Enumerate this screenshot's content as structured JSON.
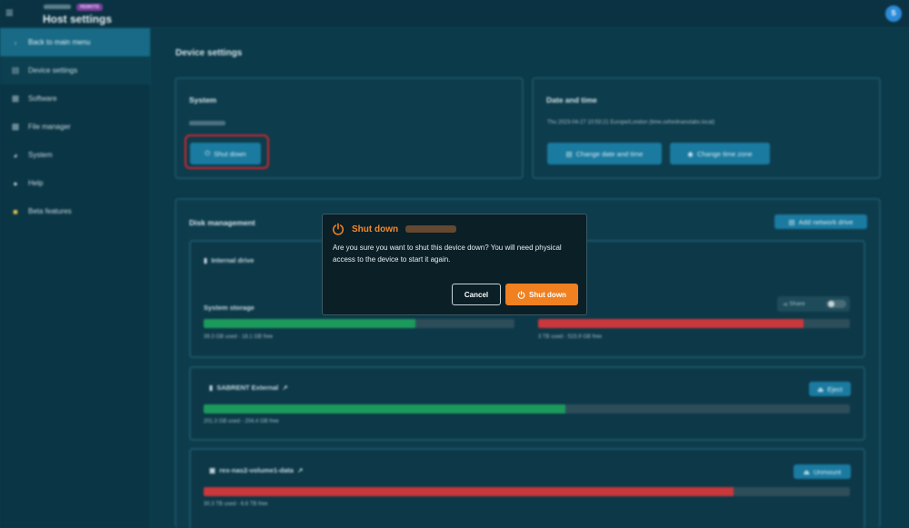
{
  "header": {
    "title": "Host settings",
    "badge": "REMOTE"
  },
  "user": {
    "initial": "S"
  },
  "sidebar": {
    "items": [
      {
        "label": "Back to main menu",
        "icon": "chevron-left-icon"
      },
      {
        "label": "Device settings",
        "icon": "device-icon"
      },
      {
        "label": "Software",
        "icon": "software-icon"
      },
      {
        "label": "File manager",
        "icon": "folder-icon"
      },
      {
        "label": "System",
        "icon": "gauge-icon"
      },
      {
        "label": "Help",
        "icon": "help-icon"
      },
      {
        "label": "Beta features",
        "icon": "beta-icon"
      }
    ]
  },
  "main": {
    "title": "Device settings",
    "system": {
      "title": "System",
      "shutdown_label": "Shut down"
    },
    "datetime": {
      "title": "Date and time",
      "value": "Thu 2023-04-27 10:53:21 Europe/London (time.oxfordnanolabs.local)",
      "change_datetime_label": "Change date and time",
      "change_timezone_label": "Change time zone"
    },
    "disk": {
      "title": "Disk management",
      "add_network_drive_label": "Add network drive",
      "internal": {
        "label": "Internal drive",
        "system_storage_label": "System storage",
        "share_label": "Share",
        "system_usage": "39.3 GB used - 18.1 GB free",
        "system_fraction": 0.68,
        "data_usage": "3 TB used - 515.9 GB free",
        "data_fraction": 0.85
      },
      "sabrent": {
        "label": "SABRENT External",
        "eject_label": "Eject",
        "usage": "201.3 GB used - 204.4 GB free",
        "fraction": 0.56
      },
      "nas": {
        "label": "rex-nas2-volume1-data",
        "unmount_label": "Unmount",
        "usage": "30.3 TB used - 6.6 TB free",
        "fraction": 0.82
      }
    }
  },
  "dialog": {
    "title": "Shut down",
    "message": "Are you sure you want to shut this device down? You will need physical access to the device to start it again.",
    "cancel_label": "Cancel",
    "confirm_label": "Shut down",
    "accent": "#f08020"
  }
}
